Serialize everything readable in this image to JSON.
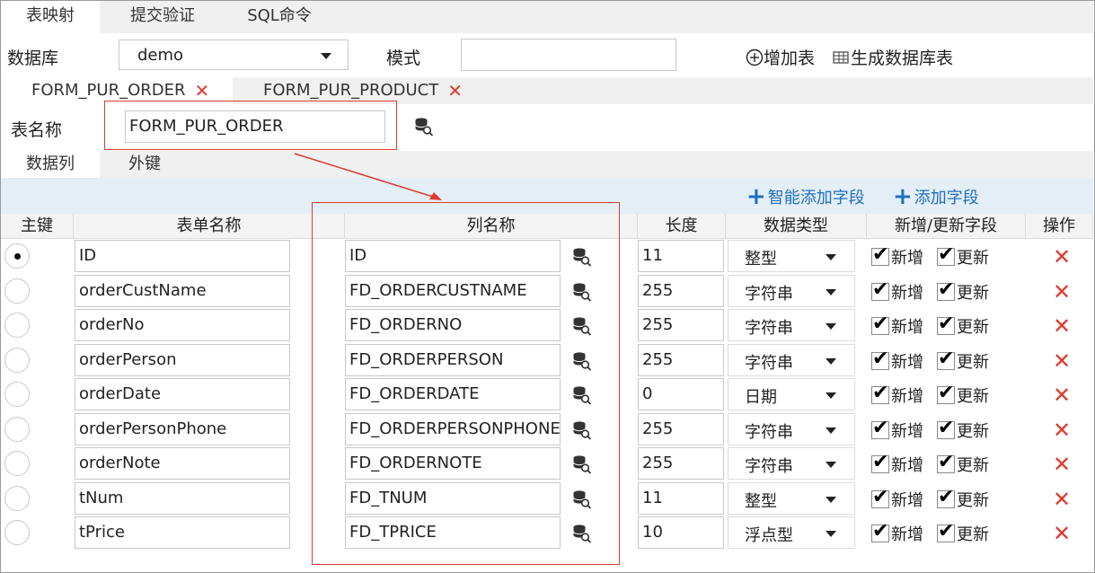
{
  "top_tabs": [
    "表映射",
    "提交验证",
    "SQL命令"
  ],
  "db_row": {
    "db_label": "数据库",
    "db_value": "demo",
    "mode_label": "模式",
    "mode_value": "",
    "add_table": "增加表",
    "gen_table": "生成数据库表"
  },
  "table_tabs": [
    {
      "label": "FORM_PUR_ORDER"
    },
    {
      "label": "FORM_PUR_PRODUCT"
    }
  ],
  "table_name_label": "表名称",
  "table_name_value": "FORM_PUR_ORDER",
  "sub_tabs": [
    "数据列",
    "外键"
  ],
  "actions": {
    "smart_add": "智能添加字段",
    "add": "添加字段"
  },
  "columns": [
    "主键",
    "表单名称",
    "列名称",
    "长度",
    "数据类型",
    "新增/更新字段",
    "操作"
  ],
  "labels": {
    "insert": "新增",
    "update": "更新"
  },
  "rows": [
    {
      "pk": true,
      "form": "ID",
      "col": "ID",
      "len": "11",
      "type": "整型"
    },
    {
      "pk": false,
      "form": "orderCustName",
      "col": "FD_ORDERCUSTNAME",
      "len": "255",
      "type": "字符串"
    },
    {
      "pk": false,
      "form": "orderNo",
      "col": "FD_ORDERNO",
      "len": "255",
      "type": "字符串"
    },
    {
      "pk": false,
      "form": "orderPerson",
      "col": "FD_ORDERPERSON",
      "len": "255",
      "type": "字符串"
    },
    {
      "pk": false,
      "form": "orderDate",
      "col": "FD_ORDERDATE",
      "len": "0",
      "type": "日期"
    },
    {
      "pk": false,
      "form": "orderPersonPhone",
      "col": "FD_ORDERPERSONPHONE",
      "len": "255",
      "type": "字符串"
    },
    {
      "pk": false,
      "form": "orderNote",
      "col": "FD_ORDERNOTE",
      "len": "255",
      "type": "字符串"
    },
    {
      "pk": false,
      "form": "tNum",
      "col": "FD_TNUM",
      "len": "11",
      "type": "整型"
    },
    {
      "pk": false,
      "form": "tPrice",
      "col": "FD_TPRICE",
      "len": "10",
      "type": "浮点型"
    }
  ],
  "colors": {
    "accent": "#1f6fbf",
    "danger": "#e03a2f",
    "highlight": "#e03a2f"
  }
}
